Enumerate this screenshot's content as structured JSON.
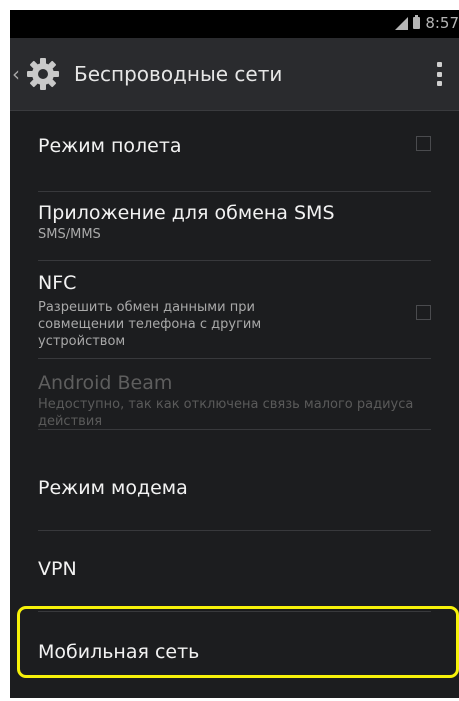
{
  "status_bar": {
    "time": "8:57",
    "icons": [
      "signal-icon",
      "battery-icon"
    ]
  },
  "action_bar": {
    "back_icon": "chevron-left-icon",
    "app_icon": "settings-gear-icon",
    "title": "Беспроводные сети",
    "menu_icon": "overflow-menu-icon"
  },
  "list": {
    "items": [
      {
        "title": "Режим полета",
        "summary": "",
        "checkbox": true,
        "checked": false,
        "enabled": true
      },
      {
        "title": "Приложение для обмена SMS",
        "summary": "SMS/MMS",
        "checkbox": false,
        "enabled": true
      },
      {
        "title": "NFC",
        "summary": "Разрешить обмен данными при совмещении телефона с другим устройством",
        "checkbox": true,
        "checked": false,
        "enabled": true
      },
      {
        "title": "Android Beam",
        "summary": "Недоступно, так как отключена связь малого радиуса действия",
        "checkbox": false,
        "enabled": false
      },
      {
        "title": "Режим модема",
        "summary": "",
        "checkbox": false,
        "enabled": true
      },
      {
        "title": "VPN",
        "summary": "",
        "checkbox": false,
        "enabled": true
      },
      {
        "title": "Мобильная сеть",
        "summary": "",
        "checkbox": false,
        "enabled": true,
        "highlighted": true
      }
    ]
  },
  "colors": {
    "background": "#1c1d1f",
    "action_bar": "#2a2b2e",
    "highlight": "#f7f20a",
    "text_primary": "#f2f2f2",
    "text_secondary": "#a9a9a9"
  }
}
